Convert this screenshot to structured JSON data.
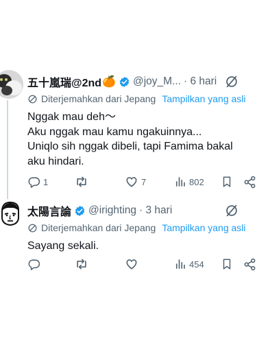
{
  "tweets": [
    {
      "display_name": "五十嵐瑞@2nd",
      "name_emoji": "🍊",
      "handle": "@joy_M...",
      "time": "· 6 hari",
      "translated_label": "Diterjemahkan dari Jepang",
      "show_original_label": "Tampilkan yang asli",
      "body_lines": [
        "Nggak mau deh〜",
        "Aku nggak mau kamu ngakuinnya...",
        "Uniqlo sih nggak dibeli, tapi Famima bakal",
        "aku hindari."
      ],
      "replies": "1",
      "retweets": "",
      "likes": "7",
      "views": "802"
    },
    {
      "display_name": "太陽言論",
      "handle": "@irighting",
      "time": "· 3 hari",
      "translated_label": "Diterjemahkan dari Jepang",
      "show_original_label": "Tampilkan yang asli",
      "body_lines": [
        "Sayang sekali."
      ],
      "replies": "",
      "retweets": "",
      "likes": "",
      "views": "454"
    }
  ],
  "icons": {
    "verified": "verified-badge-icon",
    "more": "grok-icon",
    "translate": "translate-icon",
    "reply": "reply-icon",
    "retweet": "retweet-icon",
    "like": "heart-icon",
    "views": "views-icon",
    "bookmark": "bookmark-icon",
    "share": "share-icon"
  },
  "colors": {
    "text": "#0f1419",
    "secondary": "#536471",
    "accent": "#1d9bf0",
    "thread_line": "#cfd9de"
  }
}
